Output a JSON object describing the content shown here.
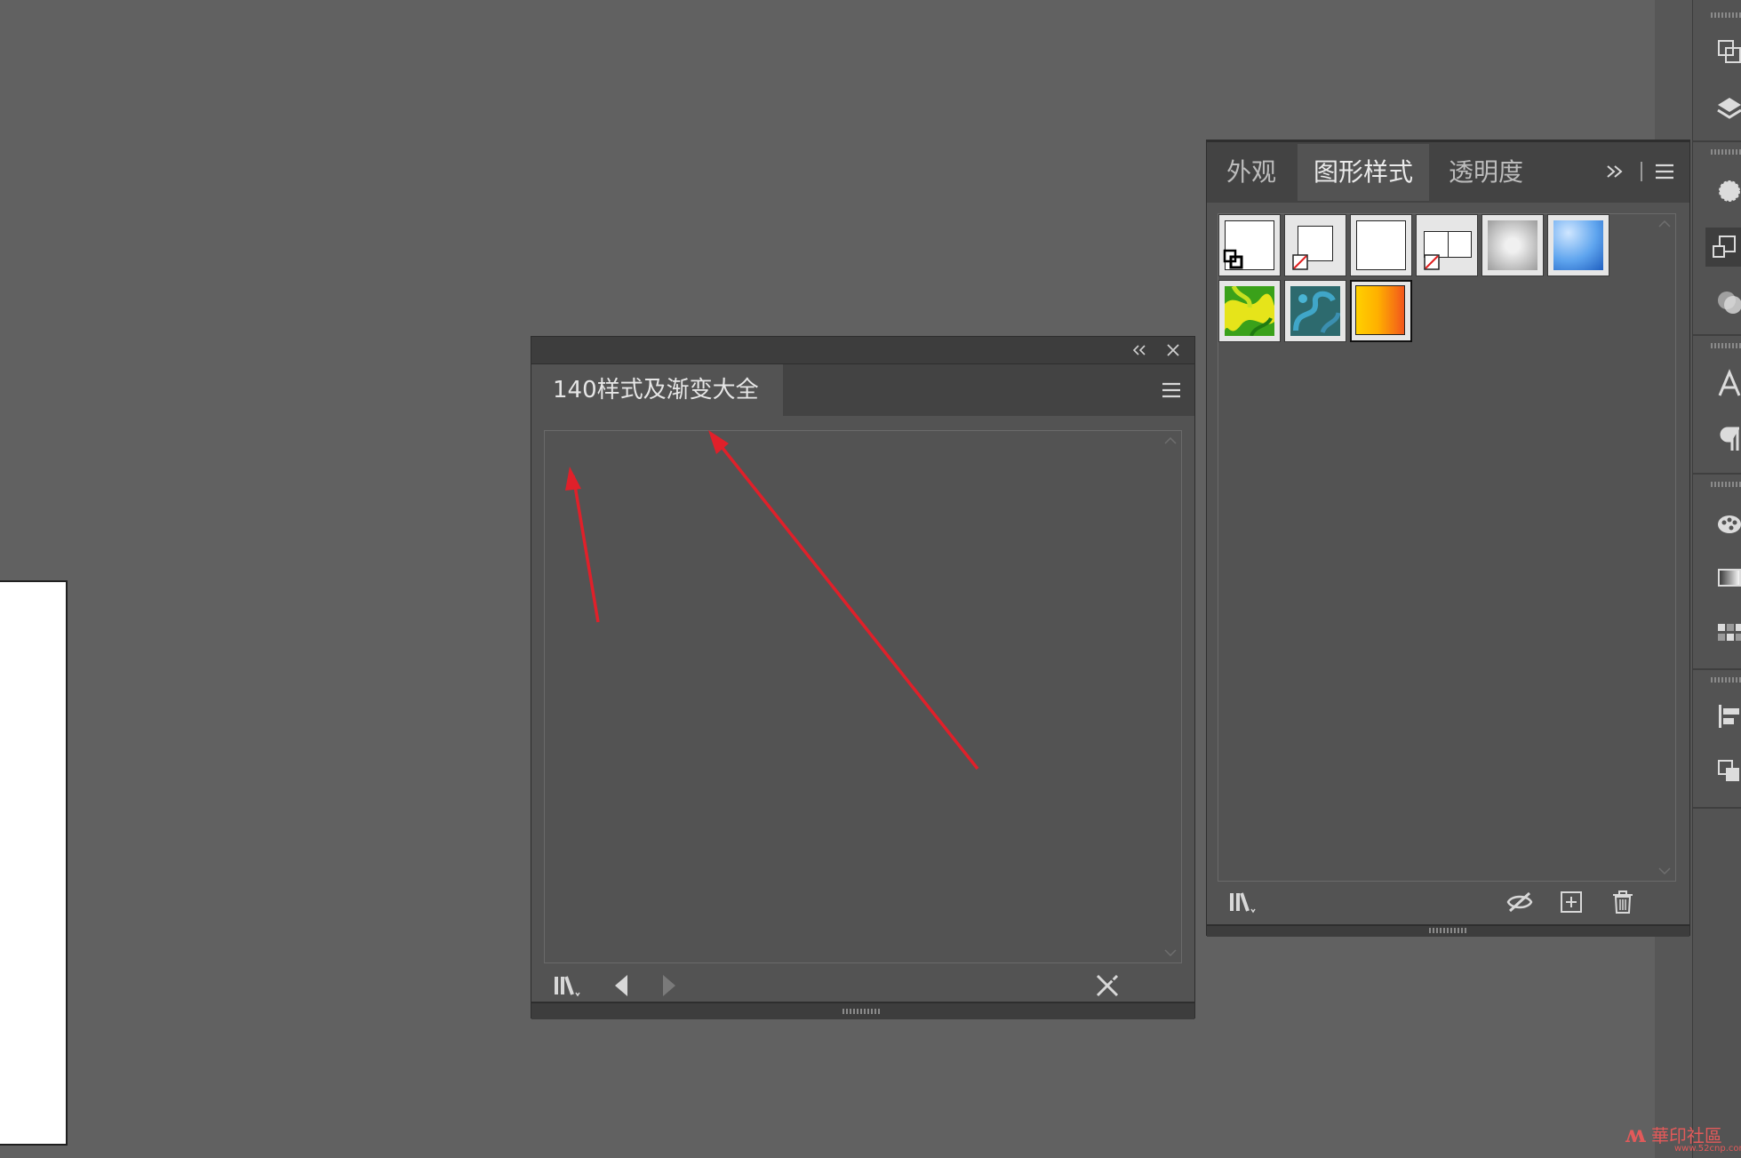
{
  "floating_panel": {
    "tab_label": "140样式及渐变大全",
    "collapse_icon": "double-chevron-left-icon",
    "close_icon": "close-icon",
    "menu_icon": "hamburger-menu-icon",
    "footer_icons": [
      "library-menu-icon",
      "previous-library-icon",
      "next-library-icon",
      "break-link-brush-icon"
    ]
  },
  "graphic_styles_panel": {
    "tabs": [
      "外观",
      "图形样式",
      "透明度"
    ],
    "active_tab": "图形样式",
    "overflow_icon": "double-chevron-right-icon",
    "menu_icon": "hamburger-menu-icon",
    "swatches": [
      {
        "name": "default-graphic-style",
        "kind": "default"
      },
      {
        "name": "no-fill-stroke-style",
        "kind": "none-stroke"
      },
      {
        "name": "white-fill-style",
        "kind": "white"
      },
      {
        "name": "double-outline-style",
        "kind": "double"
      },
      {
        "name": "grey-soft-gradient-style",
        "kind": "grey-gradient"
      },
      {
        "name": "blue-gradient-style",
        "kind": "blue-gradient"
      },
      {
        "name": "green-yellow-swirl-style",
        "kind": "green-swirl"
      },
      {
        "name": "teal-swirl-style",
        "kind": "teal-swirl"
      },
      {
        "name": "yellow-orange-gradient-style",
        "kind": "orange-gradient",
        "selected": true
      }
    ],
    "footer_icons": [
      "library-menu-icon",
      "break-link-icon",
      "new-style-icon",
      "delete-icon"
    ]
  },
  "dock_icons": [
    "artboards-icon",
    "layers-icon",
    "appearance-icon",
    "graphic-styles-icon",
    "transparency-icon",
    "character-icon",
    "paragraph-icon",
    "color-palette-icon",
    "gradient-icon",
    "swatches-icon",
    "align-icon",
    "pathfinder-icon"
  ],
  "annotations": {
    "arrow_color": "#e0202a",
    "arrow_count": 2
  },
  "watermark": {
    "text": "華印社區",
    "url": "www.52cnp.com"
  },
  "colors": {
    "background": "#616161",
    "panel": "#535353",
    "panel_dark": "#434343"
  }
}
